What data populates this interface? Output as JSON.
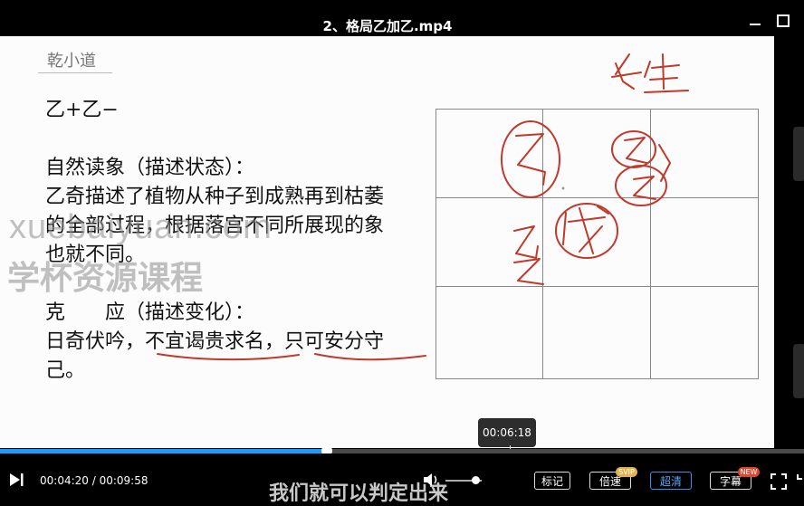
{
  "window": {
    "title": "2、格局乙加乙.mp4",
    "minimize_icon": "minimize-icon",
    "maximize_icon": "maximize-icon"
  },
  "slide": {
    "logo": "乾小道",
    "lines": [
      "乙+乙−",
      "",
      "自然读象（描述状态）：",
      "乙奇描述了植物从种子到成熟再到枯萎",
      "的全部过程，根据落宫不同所展现的象",
      "也就不同。",
      "",
      "克　　应（描述变化）：",
      "日奇伏吟，不宜谒贵求名，只可安分守",
      "己。"
    ],
    "watermark_url": "xuebaiyuan.com",
    "watermark_name": "学杯资源课程",
    "handwriting": {
      "top_right": "长生",
      "left_col_1": "乙",
      "left_col_2": "乙",
      "center_circle": "戌",
      "middle_top": "乙"
    }
  },
  "player": {
    "hover_time": "00:06:18",
    "current_time": "00:04:20",
    "separator": " / ",
    "duration": "00:09:58",
    "progress": 0.407,
    "subtitle": "我们就可以判定出来",
    "volume": 0.75,
    "buttons": {
      "mark": "标记",
      "speed": "倍速",
      "quality": "超清",
      "subtitles": "字幕"
    },
    "badges": {
      "svip": "SVIP",
      "new": "NEW"
    },
    "colors": {
      "progress": "#1e9bff",
      "quality_accent": "#58a8ff",
      "ink": "#c0392b"
    }
  }
}
